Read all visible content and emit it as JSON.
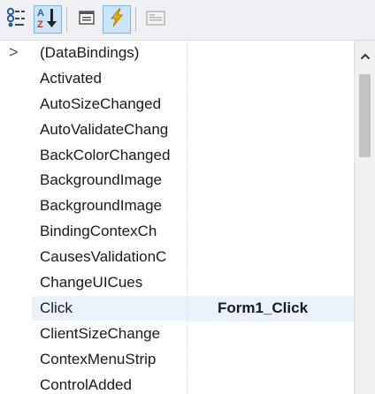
{
  "toolbar": {
    "buttons": [
      {
        "name": "categorized",
        "icon": "categorized-icon"
      },
      {
        "name": "alphabetical",
        "icon": "sort-az-icon",
        "active": true
      },
      {
        "name": "properties",
        "icon": "properties-icon"
      },
      {
        "name": "events",
        "icon": "lightning-icon",
        "active": true
      },
      {
        "name": "property-pages",
        "icon": "property-pages-icon",
        "disabled": true
      }
    ]
  },
  "grid": {
    "rows": [
      {
        "name": "(DataBindings)",
        "value": "",
        "expandable": true
      },
      {
        "name": "Activated",
        "value": ""
      },
      {
        "name": "AutoSizeChanged",
        "value": ""
      },
      {
        "name": "AutoValidateChang",
        "value": ""
      },
      {
        "name": "BackColorChanged",
        "value": ""
      },
      {
        "name": "BackgroundImage",
        "value": ""
      },
      {
        "name": "BackgroundImage",
        "value": ""
      },
      {
        "name": "BindingContexCh",
        "value": ""
      },
      {
        "name": "CausesValidationC",
        "value": ""
      },
      {
        "name": "ChangeUICues",
        "value": ""
      },
      {
        "name": "Click",
        "value": "Form1_Click",
        "selected": true
      },
      {
        "name": "ClientSizeChange",
        "value": ""
      },
      {
        "name": "ContexMenuStrip",
        "value": ""
      },
      {
        "name": "ControlAdded",
        "value": ""
      }
    ],
    "expander_glyph": ">"
  },
  "scrollbar": {
    "up_arrow": "^"
  },
  "colors": {
    "toolbar_bg": "#eef0f3",
    "active_button_bg": "#cce4f7",
    "selected_row_bg": "#eaf3fb",
    "gridline": "#e4eaf1"
  }
}
